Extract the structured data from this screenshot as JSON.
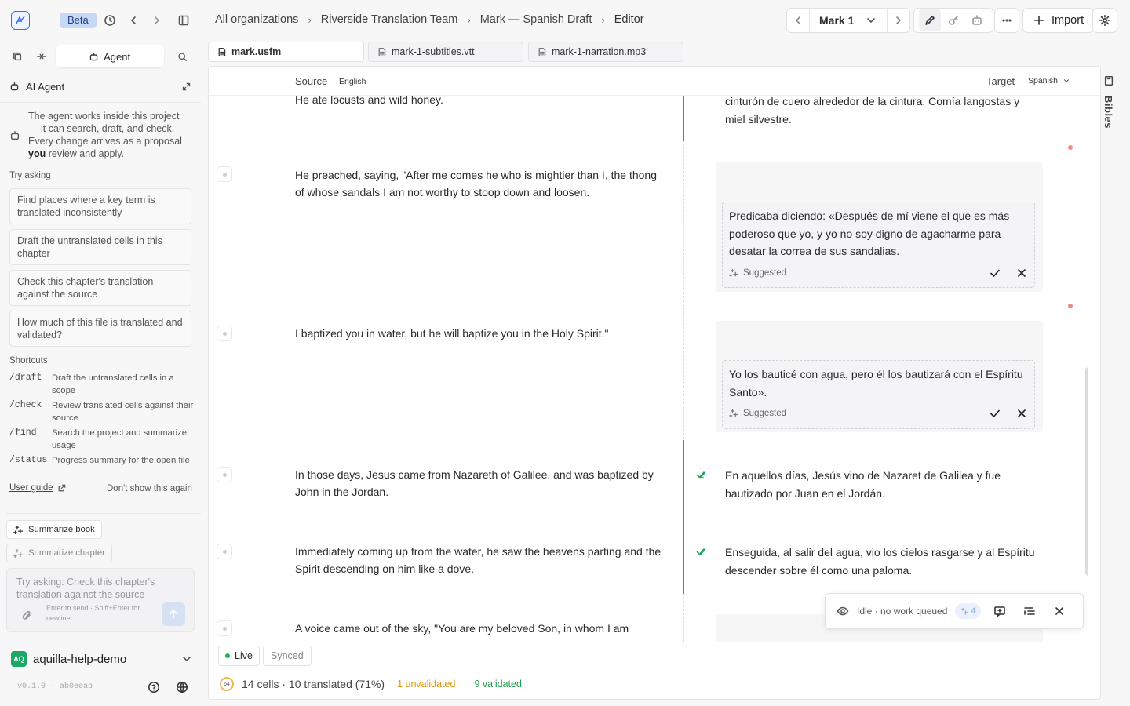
{
  "topbar": {
    "beta": "Beta",
    "breadcrumbs": [
      "All organizations",
      "Riverside Translation Team",
      "Mark — Spanish Draft",
      "Editor"
    ],
    "chapter": "Mark 1",
    "import_label": "Import"
  },
  "sidebar": {
    "agent_tab": "Agent",
    "header": "AI Agent",
    "intro": "The agent works inside this project — it can search, draft, and check. Every change arrives as a proposal",
    "intro_bold": "you",
    "intro_end": "review and apply.",
    "try_asking": "Try asking",
    "suggestions": [
      "Find places where a key term is translated inconsistently",
      "Draft the untranslated cells in this chapter",
      "Check this chapter's translation against the source",
      "How much of this file is translated and validated?"
    ],
    "shortcuts_title": "Shortcuts",
    "shortcuts": [
      {
        "cmd": "/draft",
        "desc": "Draft the untranslated cells in a scope"
      },
      {
        "cmd": "/check",
        "desc": "Review translated cells against their source"
      },
      {
        "cmd": "/find",
        "desc": "Search the project and summarize usage"
      },
      {
        "cmd": "/status",
        "desc": "Progress summary for the open file"
      }
    ],
    "user_guide": "User guide",
    "dont_show": "Don't show this again",
    "summarize_book": "Summarize book",
    "summarize_chapter": "Summarize chapter",
    "composer_placeholder": "Try asking: Check this chapter's translation against the source",
    "composer_hint": "Enter to send · Shift+Enter for newline",
    "org_badge": "AQ",
    "org_name": "aquilla-help-demo",
    "version": "v0.1.0 · ab0eeab"
  },
  "tabs": [
    {
      "label": "mark.usfm",
      "active": true
    },
    {
      "label": "mark-1-subtitles.vtt",
      "active": false
    },
    {
      "label": "mark-1-narration.mp3",
      "active": false
    }
  ],
  "editor": {
    "source_label": "Source",
    "source_lang": "English",
    "target_label": "Target",
    "target_lang": "Spanish",
    "rows": [
      {
        "source": "He ate locusts and wild honey.",
        "target": "cinturón de cuero alrededor de la cintura. Comía langostas y miel silvestre."
      },
      {
        "source": "He preached, saying, \"After me comes he who is mightier than I, the thong of whose sandals I am not worthy to stoop down and loosen.",
        "suggestion": "Predicaba diciendo: «Después de mí viene el que es más poderoso que yo, y yo no soy digno de agacharme para desatar la correa de sus sandalias.",
        "status": "Suggested"
      },
      {
        "source": "I baptized you in water, but he will baptize you in the Holy Spirit.\"",
        "suggestion": "Yo los bauticé con agua, pero él los bautizará con el Espíritu Santo».",
        "status": "Suggested"
      },
      {
        "source": "In those days, Jesus came from Nazareth of Galilee, and was baptized by John in the Jordan.",
        "target": "En aquellos días, Jesús vino de Nazaret de Galilea y fue bautizado por Juan en el Jordán."
      },
      {
        "source": "Immediately coming up from the water, he saw the heavens parting and the Spirit descending on him like a dove.",
        "target": "Enseguida, al salir del agua, vio los cielos rasgarse y al Espíritu descender sobre él como una paloma."
      },
      {
        "source": "A voice came out of the sky, \"You are my beloved Son, in whom I am"
      }
    ],
    "agent_status": "Idle · no work queued",
    "agent_count": "4",
    "live": "Live",
    "synced": "Synced",
    "ring_value": "64",
    "stats": "14 cells · 10 translated (71%)",
    "unvalidated": "1 unvalidated",
    "validated": "9 validated"
  },
  "rail": {
    "label": "Bibles"
  },
  "colors": {
    "accent": "#3b6fd8",
    "validated": "#22a560",
    "unvalidated": "#d9940e"
  }
}
